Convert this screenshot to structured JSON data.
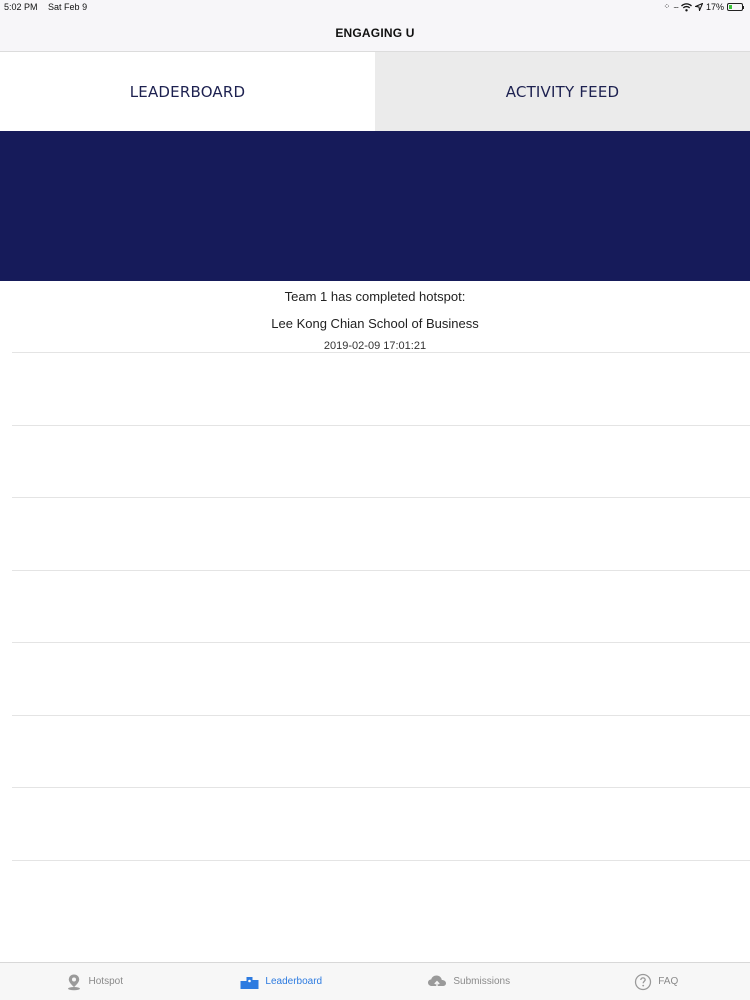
{
  "status_bar": {
    "time": "5:02 PM",
    "date": "Sat Feb 9",
    "battery_percent": "17%"
  },
  "nav": {
    "title": "ENGAGING U"
  },
  "tabs": [
    {
      "label": "LEADERBOARD",
      "selected": false
    },
    {
      "label": "ACTIVITY FEED",
      "selected": true
    }
  ],
  "feed": {
    "entries": [
      {
        "line1": "Team 1 has completed hotspot:",
        "line2": "Lee Kong Chian School of Business",
        "timestamp": "2019-02-09 17:01:21"
      }
    ]
  },
  "tab_bar": {
    "items": [
      {
        "label": "Hotspot",
        "icon": "map-pin-icon",
        "active": false
      },
      {
        "label": "Leaderboard",
        "icon": "podium-icon",
        "active": true
      },
      {
        "label": "Submissions",
        "icon": "cloud-upload-icon",
        "active": false
      },
      {
        "label": "FAQ",
        "icon": "question-circle-icon",
        "active": false
      }
    ]
  },
  "colors": {
    "banner": "#161b5a",
    "tab_text": "#1d2150",
    "active_tab_bar": "#2d7be0",
    "inactive_tab_bar": "#8a8a8a"
  }
}
